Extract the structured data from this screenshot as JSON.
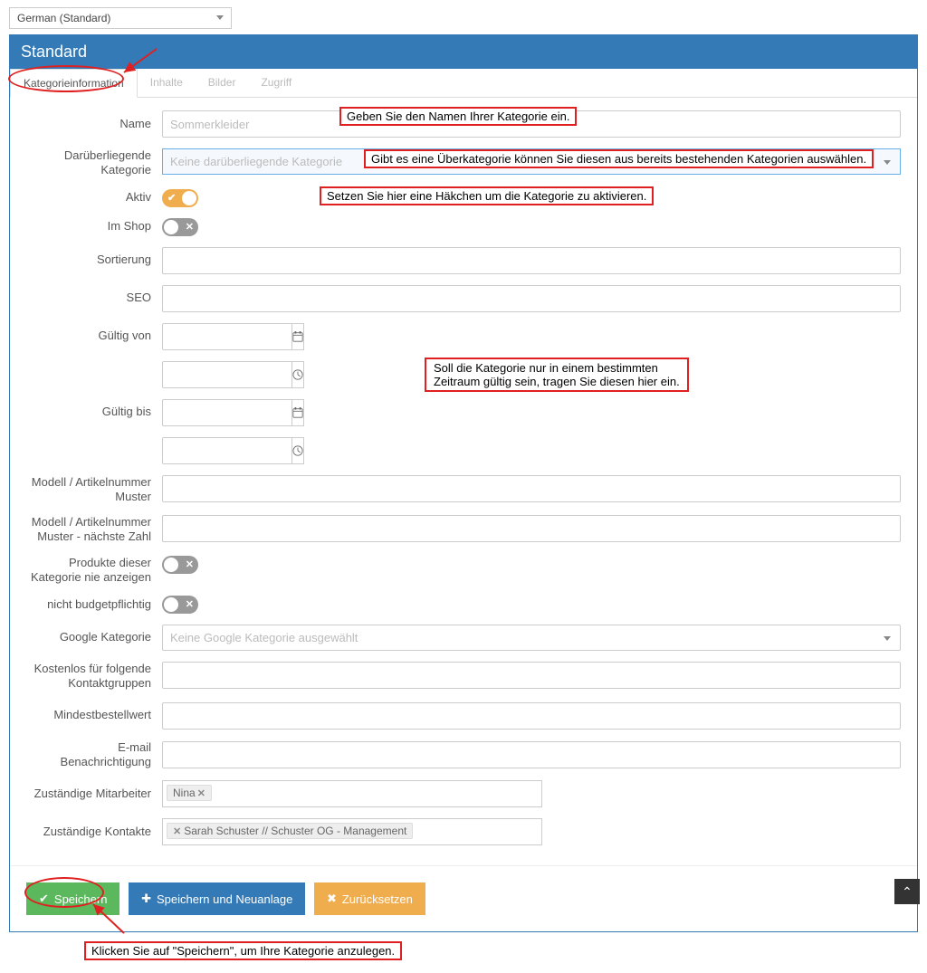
{
  "language_select": "German (Standard)",
  "panel_title": "Standard",
  "tabs": [
    "Kategorieinformation",
    "Inhalte",
    "Bilder",
    "Zugriff"
  ],
  "labels": {
    "name": "Name",
    "parent": "Darüberliegende Kategorie",
    "active": "Aktiv",
    "inshop": "Im Shop",
    "sort": "Sortierung",
    "seo": "SEO",
    "validfrom": "Gültig von",
    "validto": "Gültig bis",
    "model": "Modell / Artikelnummer Muster",
    "modelnext": "Modell / Artikelnummer Muster - nächste Zahl",
    "neverShow": "Produkte dieser Kategorie nie anzeigen",
    "notBudget": "nicht budgetpflichtig",
    "google": "Google Kategorie",
    "freeGroups": "Kostenlos für folgende Kontaktgruppen",
    "minOrder": "Mindestbestellwert",
    "emailNotif": "E-mail Benachrichtigung",
    "employees": "Zuständige Mitarbeiter",
    "contacts": "Zuständige Kontakte"
  },
  "placeholders": {
    "name": "Sommerkleider",
    "parent": "Keine darüberliegende Kategorie",
    "google": "Keine Google Kategorie ausgewählt"
  },
  "tags": {
    "employee": "Nina",
    "contact": "Sarah Schuster // Schuster OG - Management"
  },
  "buttons": {
    "save": "Speichern",
    "savenew": "Speichern und Neuanlage",
    "reset": "Zurücksetzen"
  },
  "annotations": {
    "name": "Geben Sie den Namen Ihrer Kategorie ein.",
    "parent": "Gibt es eine Überkategorie können Sie diesen aus bereits bestehenden Kategorien auswählen.",
    "active": "Setzen Sie hier eine Häkchen um die Kategorie zu aktivieren.",
    "dates1": "Soll die Kategorie nur in einem bestimmten",
    "dates2": "Zeitraum gültig sein, tragen Sie diesen hier ein.",
    "save": "Klicken Sie auf \"Speichern\", um Ihre Kategorie anzulegen."
  }
}
